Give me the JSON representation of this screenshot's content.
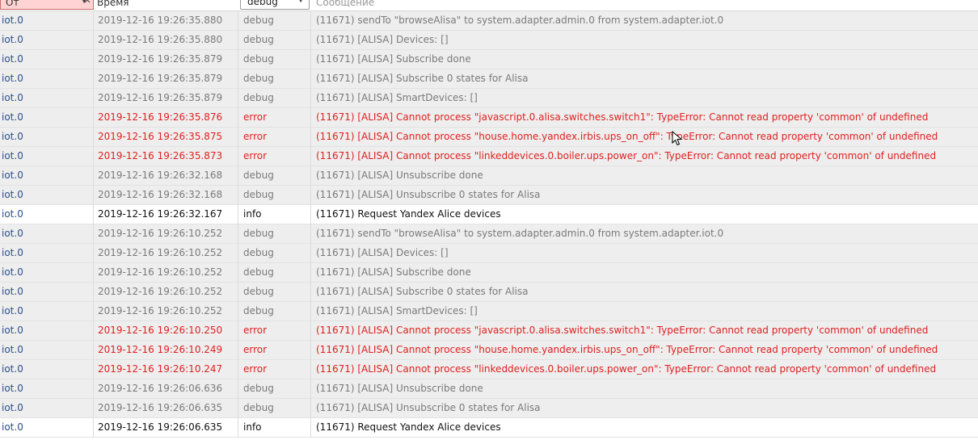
{
  "header": {
    "from_label": "От",
    "time_label": "Время",
    "level_value": "debug",
    "message_label": "Сообщение"
  },
  "rows": [
    {
      "from": "iot.0",
      "time": "2019-12-16 19:26:35.880",
      "level": "debug",
      "message": "(11671) sendTo \"browseAlisa\" to system.adapter.admin.0 from system.adapter.iot.0"
    },
    {
      "from": "iot.0",
      "time": "2019-12-16 19:26:35.880",
      "level": "debug",
      "message": "(11671) [ALISA] Devices: []"
    },
    {
      "from": "iot.0",
      "time": "2019-12-16 19:26:35.879",
      "level": "debug",
      "message": "(11671) [ALISA] Subscribe done"
    },
    {
      "from": "iot.0",
      "time": "2019-12-16 19:26:35.879",
      "level": "debug",
      "message": "(11671) [ALISA] Subscribe 0 states for Alisa"
    },
    {
      "from": "iot.0",
      "time": "2019-12-16 19:26:35.879",
      "level": "debug",
      "message": "(11671) [ALISA] SmartDevices: []"
    },
    {
      "from": "iot.0",
      "time": "2019-12-16 19:26:35.876",
      "level": "error",
      "message": "(11671) [ALISA] Cannot process \"javascript.0.alisa.switches.switch1\": TypeError: Cannot read property 'common' of undefined"
    },
    {
      "from": "iot.0",
      "time": "2019-12-16 19:26:35.875",
      "level": "error",
      "message": "(11671) [ALISA] Cannot process \"house.home.yandex.irbis.ups_on_off\": TypeError: Cannot read property 'common' of undefined"
    },
    {
      "from": "iot.0",
      "time": "2019-12-16 19:26:35.873",
      "level": "error",
      "message": "(11671) [ALISA] Cannot process \"linkeddevices.0.boiler.ups.power_on\": TypeError: Cannot read property 'common' of undefined"
    },
    {
      "from": "iot.0",
      "time": "2019-12-16 19:26:32.168",
      "level": "debug",
      "message": "(11671) [ALISA] Unsubscribe done"
    },
    {
      "from": "iot.0",
      "time": "2019-12-16 19:26:32.168",
      "level": "debug",
      "message": "(11671) [ALISA] Unsubscribe 0 states for Alisa"
    },
    {
      "from": "iot.0",
      "time": "2019-12-16 19:26:32.167",
      "level": "info",
      "message": "(11671) Request Yandex Alice devices"
    },
    {
      "from": "iot.0",
      "time": "2019-12-16 19:26:10.252",
      "level": "debug",
      "message": "(11671) sendTo \"browseAlisa\" to system.adapter.admin.0 from system.adapter.iot.0"
    },
    {
      "from": "iot.0",
      "time": "2019-12-16 19:26:10.252",
      "level": "debug",
      "message": "(11671) [ALISA] Devices: []"
    },
    {
      "from": "iot.0",
      "time": "2019-12-16 19:26:10.252",
      "level": "debug",
      "message": "(11671) [ALISA] Subscribe done"
    },
    {
      "from": "iot.0",
      "time": "2019-12-16 19:26:10.252",
      "level": "debug",
      "message": "(11671) [ALISA] Subscribe 0 states for Alisa"
    },
    {
      "from": "iot.0",
      "time": "2019-12-16 19:26:10.252",
      "level": "debug",
      "message": "(11671) [ALISA] SmartDevices: []"
    },
    {
      "from": "iot.0",
      "time": "2019-12-16 19:26:10.250",
      "level": "error",
      "message": "(11671) [ALISA] Cannot process \"javascript.0.alisa.switches.switch1\": TypeError: Cannot read property 'common' of undefined"
    },
    {
      "from": "iot.0",
      "time": "2019-12-16 19:26:10.249",
      "level": "error",
      "message": "(11671) [ALISA] Cannot process \"house.home.yandex.irbis.ups_on_off\": TypeError: Cannot read property 'common' of undefined"
    },
    {
      "from": "iot.0",
      "time": "2019-12-16 19:26:10.247",
      "level": "error",
      "message": "(11671) [ALISA] Cannot process \"linkeddevices.0.boiler.ups.power_on\": TypeError: Cannot read property 'common' of undefined"
    },
    {
      "from": "iot.0",
      "time": "2019-12-16 19:26:06.636",
      "level": "debug",
      "message": "(11671) [ALISA] Unsubscribe done"
    },
    {
      "from": "iot.0",
      "time": "2019-12-16 19:26:06.635",
      "level": "debug",
      "message": "(11671) [ALISA] Unsubscribe 0 states for Alisa"
    },
    {
      "from": "iot.0",
      "time": "2019-12-16 19:26:06.635",
      "level": "info",
      "message": "(11671) Request Yandex Alice devices"
    }
  ],
  "colors": {
    "debug_text": "#7a7a7a",
    "error_text": "#e02020",
    "info_text": "#111111",
    "from_text": "#2c4f8c",
    "filter_active_bg": "#ffd3d3"
  }
}
